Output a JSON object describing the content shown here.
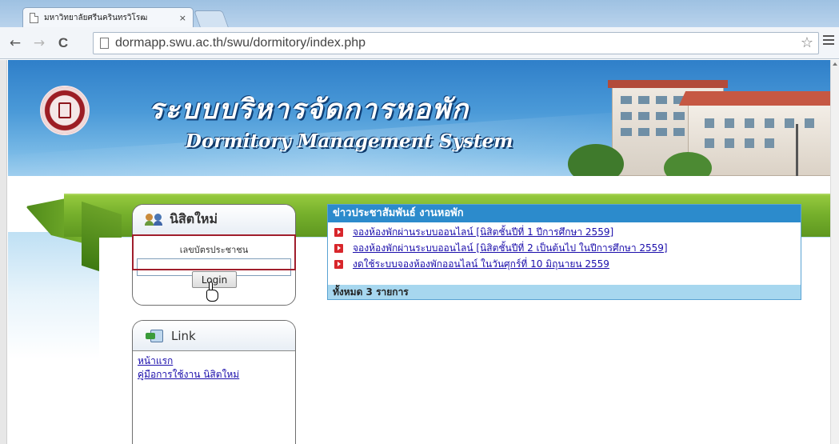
{
  "browser": {
    "tab_title": "มหาวิทยาลัยศรีนครินทรวิโรฒ",
    "tab_close": "×",
    "url": "dormapp.swu.ac.th/swu/dormitory/index.php",
    "back_glyph": "←",
    "forward_glyph": "→",
    "reload_glyph": "C",
    "star_glyph": "☆"
  },
  "header": {
    "title_thai": "ระบบบริหารจัดการหอพัก",
    "title_eng": "Dormitory Management System"
  },
  "login": {
    "box_title": "นิสิตใหม่",
    "field_label": "เลขบัตรประชาชน",
    "field_value": ".............",
    "button_label": "Login"
  },
  "links": {
    "box_title": "Link",
    "items": [
      "หน้าแรก",
      "คู่มือการใช้งาน นิสิตใหม่"
    ]
  },
  "news": {
    "title": "ข่าวประชาสัมพันธ์ งานหอพัก",
    "items": [
      "จองห้องพักผ่านระบบออนไลน์ [นิสิตชั้นปีที่ 1 ปีการศึกษา 2559]",
      "จองห้องพักผ่านระบบออนไลน์ [นิสิตชั้นปีที่ 2 เป็นต้นไป ในปีการศึกษา 2559]",
      "งดใช้ระบบจองห้องพักออนไลน์ ในวันศุกร์ที่ 10 มิถุนายน 2559"
    ],
    "footer": "ทั้งหมด 3 รายการ"
  },
  "colors": {
    "banner_blue": "#2f7fc9",
    "ribbon_green": "#76b02c",
    "news_header": "#2c8bcc",
    "highlight_red": "#a01e2c"
  }
}
